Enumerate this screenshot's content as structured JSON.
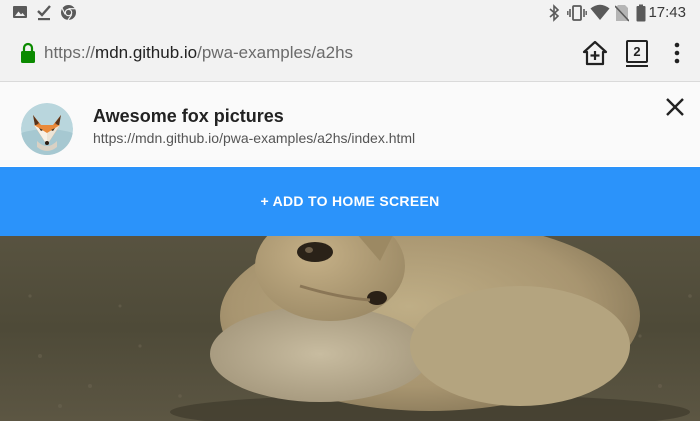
{
  "status_bar": {
    "time": "17:43",
    "left_icons": [
      "image-icon",
      "check-icon",
      "chrome-icon"
    ],
    "right_icons": [
      "bluetooth-icon",
      "vibrate-icon",
      "wifi-icon",
      "no-sim-icon",
      "battery-icon"
    ]
  },
  "address_bar": {
    "scheme": "https://",
    "host": "mdn.github.io",
    "path": "/pwa-examples/a2hs",
    "tab_count": "2",
    "secure": true,
    "secure_color": "#0b8a00"
  },
  "banner": {
    "app_name": "Awesome fox pictures",
    "app_url": "https://mdn.github.io/pwa-examples/a2hs/index.html"
  },
  "add_button": {
    "label": "+ ADD TO HOME SCREEN",
    "color": "#2b93fa"
  }
}
